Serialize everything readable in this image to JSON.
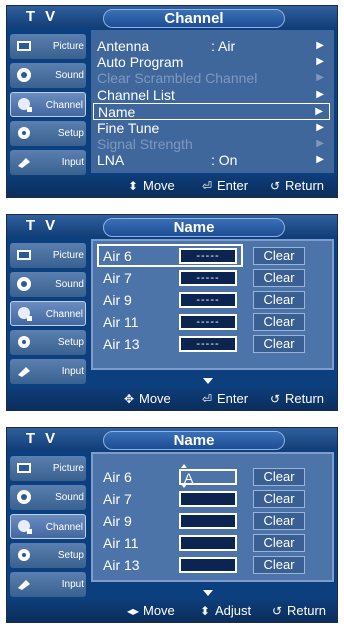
{
  "sidebar": {
    "items": [
      {
        "label": "Picture",
        "icon": "picture-icon"
      },
      {
        "label": "Sound",
        "icon": "sound-icon"
      },
      {
        "label": "Channel",
        "icon": "channel-icon"
      },
      {
        "label": "Setup",
        "icon": "setup-icon"
      },
      {
        "label": "Input",
        "icon": "input-icon"
      }
    ]
  },
  "screen1": {
    "tv": "T V",
    "title": "Channel",
    "menu": [
      {
        "label": "Antenna",
        "value": ": Air",
        "enabled": true
      },
      {
        "label": "Auto Program",
        "value": "",
        "enabled": true
      },
      {
        "label": "Clear Scrambled Channel",
        "value": "",
        "enabled": false
      },
      {
        "label": "Channel List",
        "value": "",
        "enabled": true
      },
      {
        "label": "Name",
        "value": "",
        "enabled": true,
        "selected": true
      },
      {
        "label": "Fine Tune",
        "value": "",
        "enabled": true
      },
      {
        "label": "Signal Strength",
        "value": "",
        "enabled": false
      },
      {
        "label": "LNA",
        "value": ": On",
        "enabled": true
      }
    ],
    "footer": {
      "move": "Move",
      "enter": "Enter",
      "return": "Return"
    }
  },
  "screen2": {
    "tv": "T V",
    "title": "Name",
    "rows": [
      {
        "channel": "Air 6",
        "name": "-----",
        "clear": "Clear"
      },
      {
        "channel": "Air 7",
        "name": "-----",
        "clear": "Clear"
      },
      {
        "channel": "Air 9",
        "name": "-----",
        "clear": "Clear"
      },
      {
        "channel": "Air 11",
        "name": "-----",
        "clear": "Clear"
      },
      {
        "channel": "Air 13",
        "name": "-----",
        "clear": "Clear"
      }
    ],
    "footer": {
      "move": "Move",
      "enter": "Enter",
      "return": "Return"
    }
  },
  "screen3": {
    "tv": "T V",
    "title": "Name",
    "rows": [
      {
        "channel": "Air 6",
        "name": "A",
        "clear": "Clear"
      },
      {
        "channel": "Air 7",
        "name": "",
        "clear": "Clear"
      },
      {
        "channel": "Air 9",
        "name": "",
        "clear": "Clear"
      },
      {
        "channel": "Air 11",
        "name": "",
        "clear": "Clear"
      },
      {
        "channel": "Air 13",
        "name": "",
        "clear": "Clear"
      }
    ],
    "footer": {
      "move": "Move",
      "adjust": "Adjust",
      "return": "Return"
    }
  },
  "colors": {
    "background": "#0c3f7d",
    "panel": "#4d74a9",
    "text": "#ffffff",
    "disabled_text": "#7f98bd"
  }
}
